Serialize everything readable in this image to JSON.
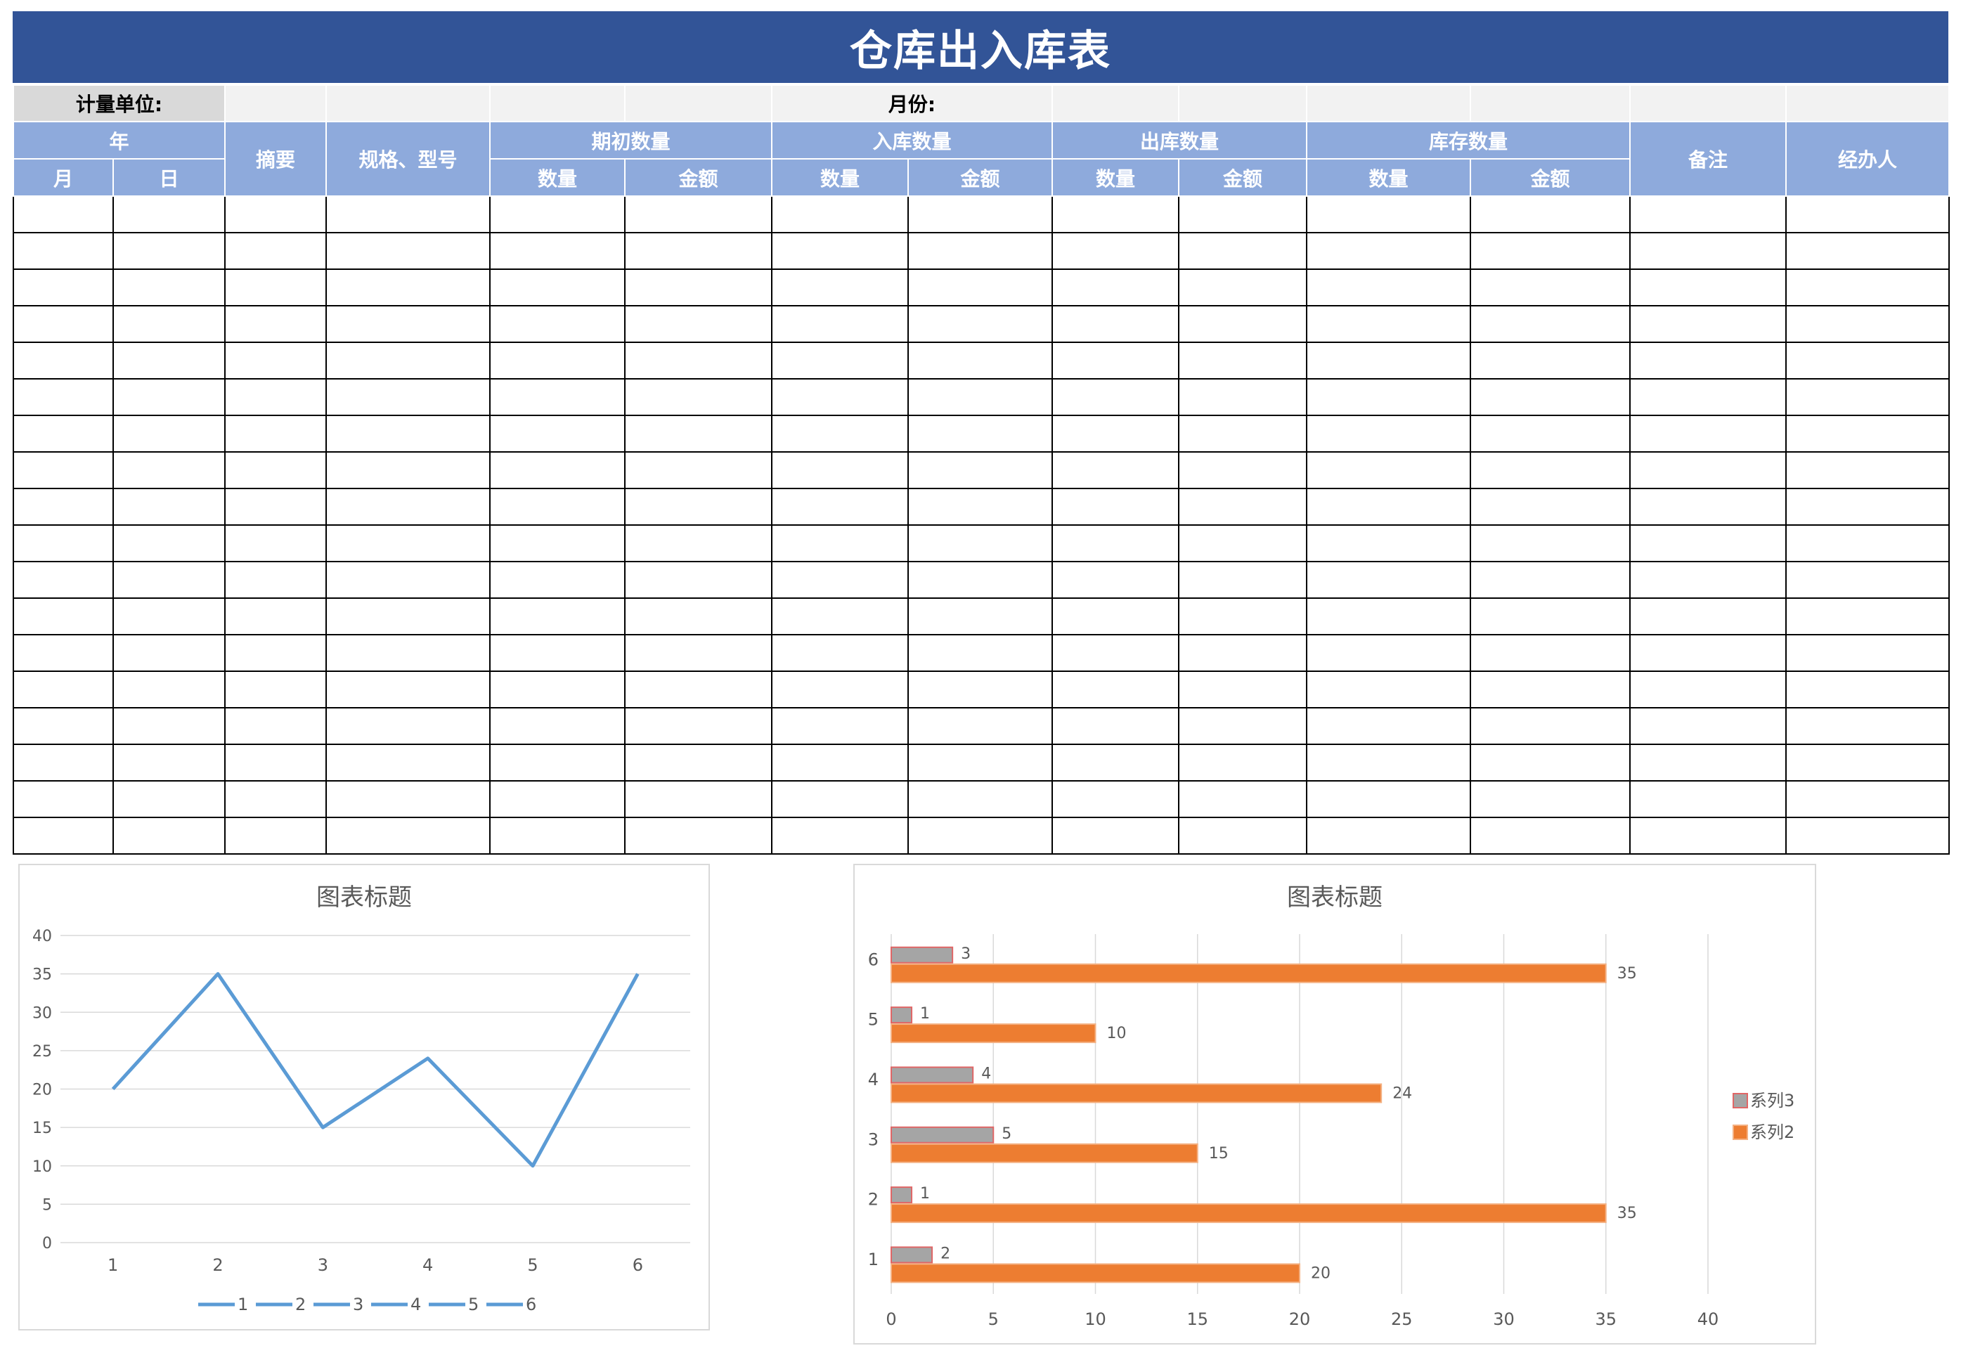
{
  "title": "仓库出入库表",
  "info_row": {
    "unit_label": "计量单位:",
    "month_label": "月份:"
  },
  "headers": {
    "year": "年",
    "month": "月",
    "day": "日",
    "summary": "摘要",
    "spec": "规格、型号",
    "opening": "期初数量",
    "inbound": "入库数量",
    "outbound": "出库数量",
    "stock": "库存数量",
    "qty": "数量",
    "amount": "金额",
    "remark": "备注",
    "handler": "经办人"
  },
  "body_row_count": 18,
  "colors": {
    "title_bg": "#325497",
    "header_bg": "#8eaadc",
    "line": "#5b9bd5",
    "series2": "#ed7d31",
    "series3": "#a5a5a5"
  },
  "chart_data": [
    {
      "type": "line",
      "title": "图表标题",
      "categories": [
        "1",
        "2",
        "3",
        "4",
        "5",
        "6"
      ],
      "values": [
        20,
        35,
        15,
        24,
        10,
        35
      ],
      "ylim": [
        0,
        40
      ],
      "yticks": [
        0,
        5,
        10,
        15,
        20,
        25,
        30,
        35,
        40
      ],
      "legend": [
        "1",
        "2",
        "3",
        "4",
        "5",
        "6"
      ],
      "legend_position": "bottom",
      "grid": true
    },
    {
      "type": "bar",
      "orientation": "horizontal",
      "title": "图表标题",
      "categories": [
        "1",
        "2",
        "3",
        "4",
        "5",
        "6"
      ],
      "series": [
        {
          "name": "系列3",
          "values": [
            2,
            1,
            5,
            4,
            1,
            3
          ]
        },
        {
          "name": "系列2",
          "values": [
            20,
            35,
            15,
            24,
            10,
            35
          ]
        }
      ],
      "xlim": [
        0,
        40
      ],
      "xticks": [
        0,
        5,
        10,
        15,
        20,
        25,
        30,
        35,
        40
      ],
      "legend_position": "right",
      "grid": true
    }
  ]
}
